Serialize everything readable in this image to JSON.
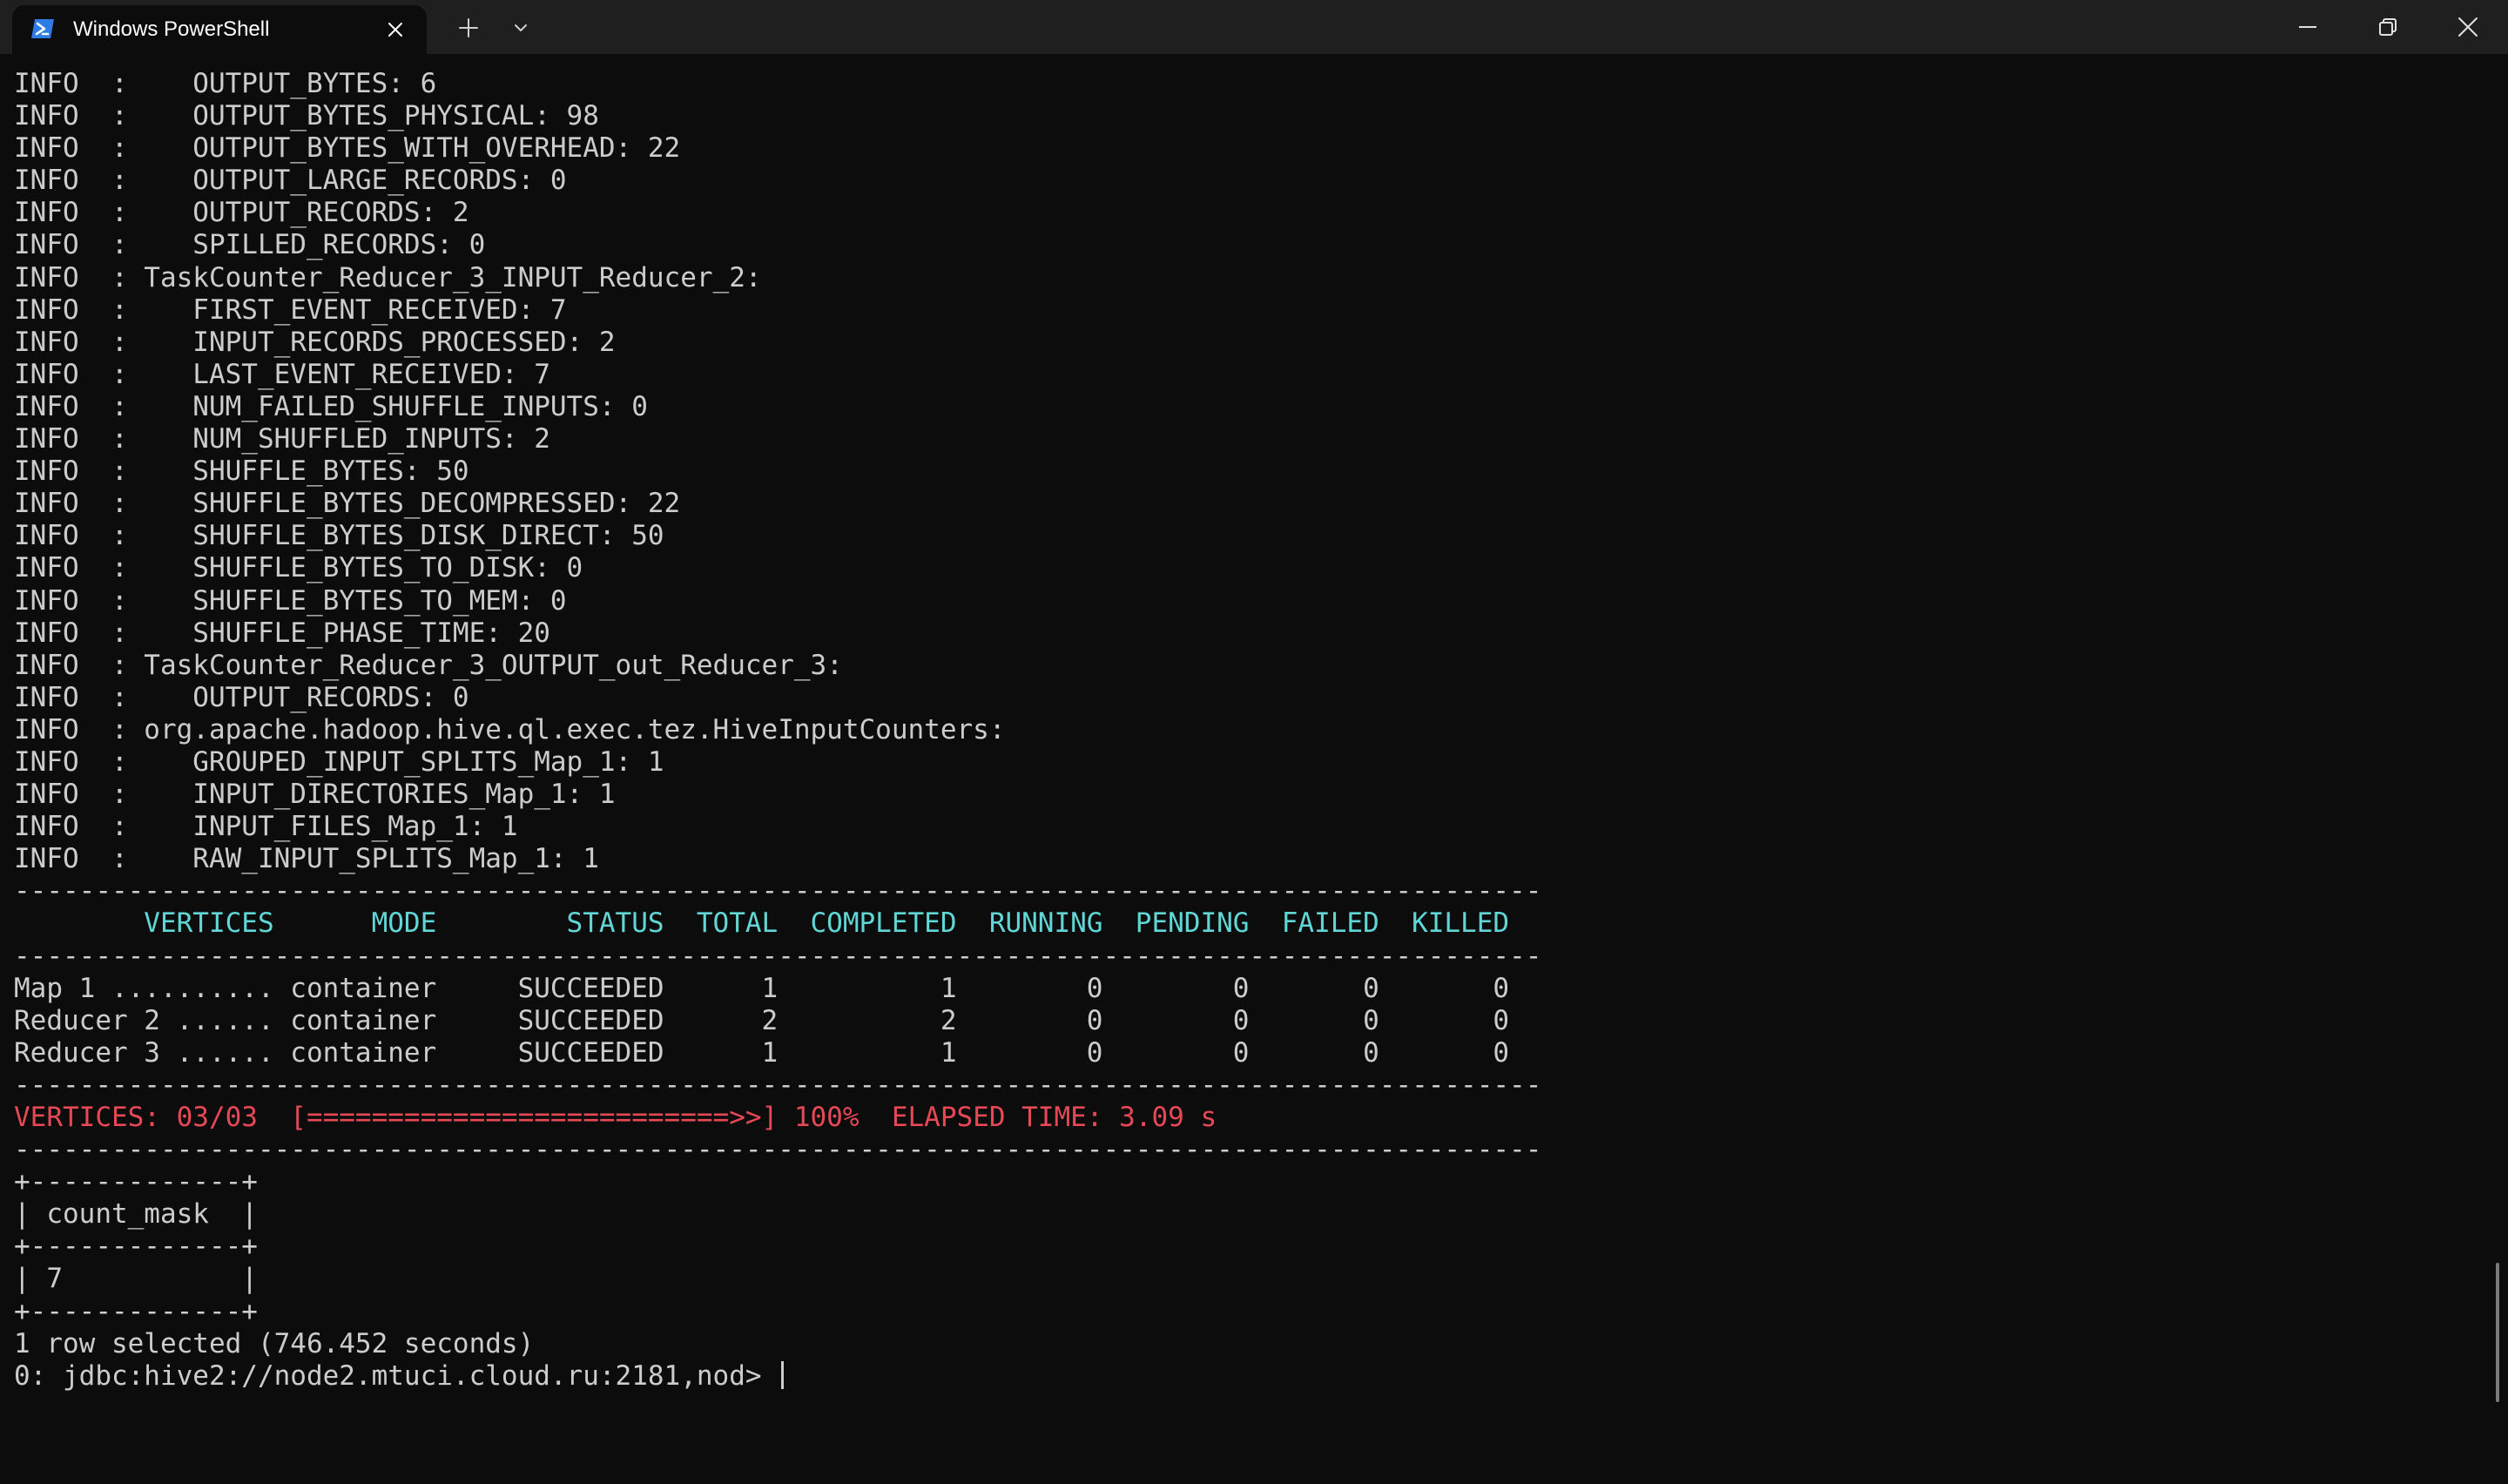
{
  "window": {
    "tab_title": "Windows PowerShell",
    "tab_icon": "powershell-icon",
    "new_tab_icon": "plus-icon",
    "dropdown_icon": "chevron-down-icon",
    "minimize_icon": "minimize-icon",
    "maximize_icon": "restore-icon",
    "close_icon": "close-icon",
    "accent_color": "#2d7be5"
  },
  "terminal": {
    "colors": {
      "background": "#0c0c0c",
      "foreground": "#cccccc",
      "header": "#61d6d6",
      "progress": "#e74856"
    },
    "lines": [
      {
        "text": "INFO  :    OUTPUT_BYTES: 6",
        "style": ""
      },
      {
        "text": "INFO  :    OUTPUT_BYTES_PHYSICAL: 98",
        "style": ""
      },
      {
        "text": "INFO  :    OUTPUT_BYTES_WITH_OVERHEAD: 22",
        "style": ""
      },
      {
        "text": "INFO  :    OUTPUT_LARGE_RECORDS: 0",
        "style": ""
      },
      {
        "text": "INFO  :    OUTPUT_RECORDS: 2",
        "style": ""
      },
      {
        "text": "INFO  :    SPILLED_RECORDS: 0",
        "style": ""
      },
      {
        "text": "INFO  : TaskCounter_Reducer_3_INPUT_Reducer_2:",
        "style": ""
      },
      {
        "text": "INFO  :    FIRST_EVENT_RECEIVED: 7",
        "style": ""
      },
      {
        "text": "INFO  :    INPUT_RECORDS_PROCESSED: 2",
        "style": ""
      },
      {
        "text": "INFO  :    LAST_EVENT_RECEIVED: 7",
        "style": ""
      },
      {
        "text": "INFO  :    NUM_FAILED_SHUFFLE_INPUTS: 0",
        "style": ""
      },
      {
        "text": "INFO  :    NUM_SHUFFLED_INPUTS: 2",
        "style": ""
      },
      {
        "text": "INFO  :    SHUFFLE_BYTES: 50",
        "style": ""
      },
      {
        "text": "INFO  :    SHUFFLE_BYTES_DECOMPRESSED: 22",
        "style": ""
      },
      {
        "text": "INFO  :    SHUFFLE_BYTES_DISK_DIRECT: 50",
        "style": ""
      },
      {
        "text": "INFO  :    SHUFFLE_BYTES_TO_DISK: 0",
        "style": ""
      },
      {
        "text": "INFO  :    SHUFFLE_BYTES_TO_MEM: 0",
        "style": ""
      },
      {
        "text": "INFO  :    SHUFFLE_PHASE_TIME: 20",
        "style": ""
      },
      {
        "text": "INFO  : TaskCounter_Reducer_3_OUTPUT_out_Reducer_3:",
        "style": ""
      },
      {
        "text": "INFO  :    OUTPUT_RECORDS: 0",
        "style": ""
      },
      {
        "text": "INFO  : org.apache.hadoop.hive.ql.exec.tez.HiveInputCounters:",
        "style": ""
      },
      {
        "text": "INFO  :    GROUPED_INPUT_SPLITS_Map_1: 1",
        "style": ""
      },
      {
        "text": "INFO  :    INPUT_DIRECTORIES_Map_1: 1",
        "style": ""
      },
      {
        "text": "INFO  :    INPUT_FILES_Map_1: 1",
        "style": ""
      },
      {
        "text": "INFO  :    RAW_INPUT_SPLITS_Map_1: 1",
        "style": ""
      },
      {
        "text": "----------------------------------------------------------------------------------------------",
        "style": ""
      },
      {
        "text": "        VERTICES      MODE        STATUS  TOTAL  COMPLETED  RUNNING  PENDING  FAILED  KILLED",
        "style": "cyan"
      },
      {
        "text": "----------------------------------------------------------------------------------------------",
        "style": ""
      },
      {
        "text": "Map 1 .......... container     SUCCEEDED      1          1        0        0       0       0",
        "style": ""
      },
      {
        "text": "Reducer 2 ...... container     SUCCEEDED      2          2        0        0       0       0",
        "style": ""
      },
      {
        "text": "Reducer 3 ...... container     SUCCEEDED      1          1        0        0       0       0",
        "style": ""
      },
      {
        "text": "----------------------------------------------------------------------------------------------",
        "style": ""
      },
      {
        "text": "VERTICES: 03/03  [==========================>>] 100%  ELAPSED TIME: 3.09 s",
        "style": "red"
      },
      {
        "text": "----------------------------------------------------------------------------------------------",
        "style": ""
      },
      {
        "text": "+-------------+",
        "style": ""
      },
      {
        "text": "| count_mask  |",
        "style": ""
      },
      {
        "text": "+-------------+",
        "style": ""
      },
      {
        "text": "| 7           |",
        "style": ""
      },
      {
        "text": "+-------------+",
        "style": ""
      },
      {
        "text": "1 row selected (746.452 seconds)",
        "style": ""
      }
    ],
    "prompt": "0: jdbc:hive2://node2.mtuci.cloud.ru:2181,nod> "
  }
}
